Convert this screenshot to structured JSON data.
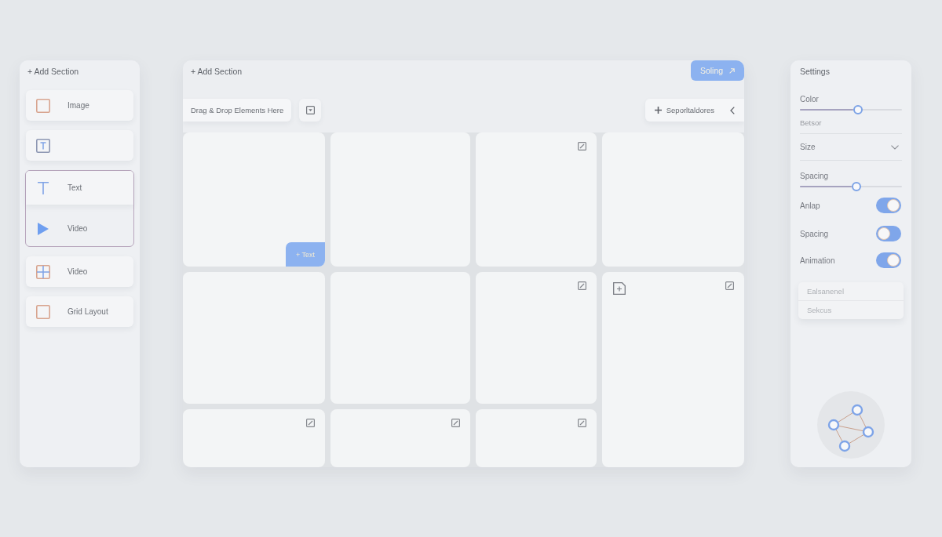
{
  "sidebar": {
    "title": "+ Add Section",
    "items": [
      {
        "kind": "card",
        "label": "Image",
        "selected": false
      },
      {
        "kind": "card",
        "selected": false
      },
      {
        "kind": "group",
        "selected": true,
        "items": [
          {
            "label": "Text"
          },
          {
            "label": "Video"
          }
        ]
      },
      {
        "kind": "card",
        "label": "Video",
        "selected": false
      },
      {
        "kind": "card",
        "label": "Grid Layout",
        "selected": false
      }
    ]
  },
  "canvas": {
    "title": "+ Add Section",
    "primary_button": "Soling",
    "drop_hint": "Drag & Drop Elements Here",
    "chip": "Seporltaldores",
    "cell_tab": "+ Text"
  },
  "settings": {
    "title": "Settings",
    "controls": [
      {
        "kind": "slider",
        "label": "Color",
        "level": 0.57,
        "caption": "Betsor"
      },
      {
        "kind": "select",
        "label": "Size"
      },
      {
        "kind": "slider",
        "label": "Spacing",
        "level": 0.55
      },
      {
        "kind": "toggle",
        "label": "Anlap",
        "on": true
      },
      {
        "kind": "toggle",
        "label": "Spacing",
        "on": false
      },
      {
        "kind": "toggle",
        "label": "Animation",
        "on": true
      }
    ],
    "menu": [
      "Ealsanenel",
      "Sekcus"
    ]
  }
}
